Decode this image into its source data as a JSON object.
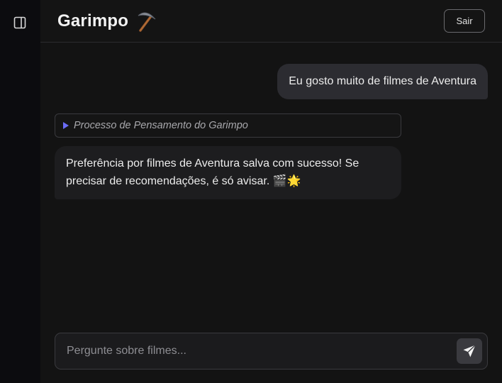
{
  "header": {
    "title": "Garimpo",
    "brand_icon": "pickaxe-icon",
    "logout_label": "Sair"
  },
  "sidebar": {
    "toggle_icon": "sidebar-panel-icon"
  },
  "chat": {
    "messages": [
      {
        "role": "user",
        "text": "Eu gosto muito de filmes de Aventura"
      },
      {
        "role": "assistant",
        "thinking_label": "Processo de Pensamento do Garimpo",
        "text": "Preferência por filmes de Aventura salva com sucesso! Se precisar de recomendações, é só avisar. 🎬🌟"
      }
    ]
  },
  "composer": {
    "placeholder": "Pergunte sobre filmes...",
    "value": "",
    "send_icon": "send-icon"
  },
  "colors": {
    "accent": "#6b6cf6",
    "background": "#131313",
    "sidebar": "#0c0c0f"
  }
}
